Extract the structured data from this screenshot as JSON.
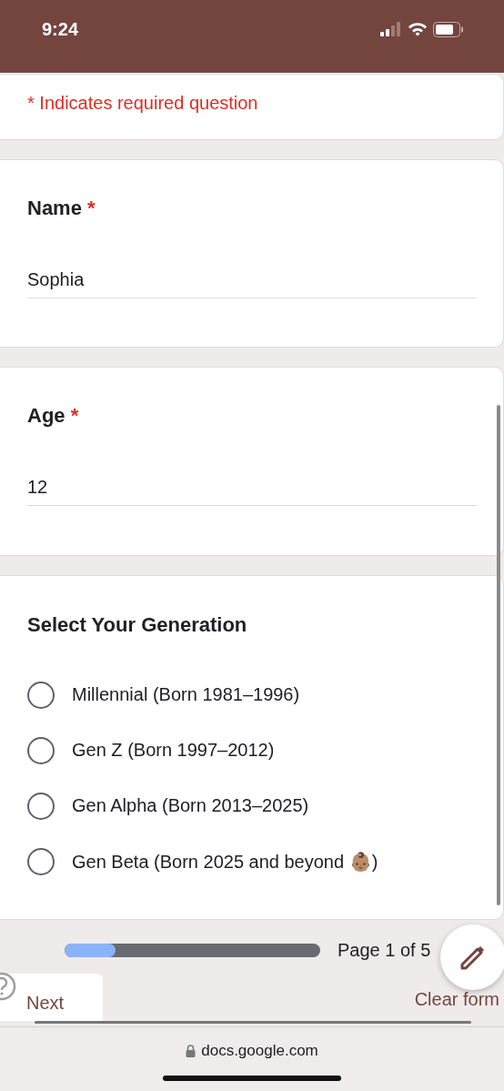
{
  "status_bar": {
    "time": "9:24"
  },
  "required_note": "* Indicates required question",
  "questions": [
    {
      "kind": "text",
      "title": "Name",
      "required_mark": "*",
      "value": "Sophia"
    },
    {
      "kind": "text",
      "title": "Age",
      "required_mark": "*",
      "value": "12"
    },
    {
      "kind": "choice",
      "title": "Select Your Generation",
      "options": [
        {
          "label": "Millennial (Born 1981–1996)",
          "selected": false
        },
        {
          "label": "Gen Z (Born 1997–2012)",
          "selected": false
        },
        {
          "label": "Gen Alpha (Born 2013–2025)",
          "selected": false
        },
        {
          "label": "Gen Beta (Born 2025 and beyond 👶🏽)",
          "selected": false
        }
      ]
    }
  ],
  "footer": {
    "progress": {
      "level": 0.2
    },
    "page_label": "Page 1 of 5",
    "next_button": "Next",
    "clear_button": "Clear form"
  },
  "browser": {
    "url": "docs.google.com"
  }
}
